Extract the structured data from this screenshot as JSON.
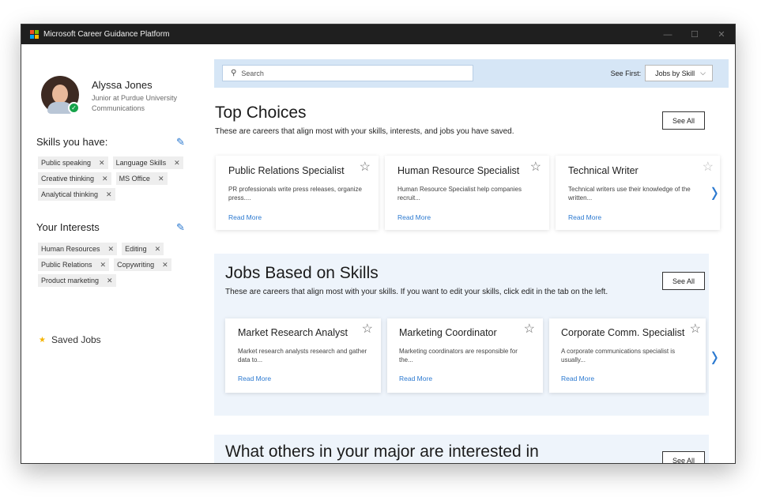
{
  "window": {
    "title": "Microsoft Career Guidance Platform",
    "logo_colors": [
      "#f25022",
      "#7fba00",
      "#00a4ef",
      "#ffb900"
    ],
    "controls": [
      "—",
      "☐",
      "✕"
    ]
  },
  "profile": {
    "name": "Alyssa Jones",
    "line1": "Junior at Purdue University",
    "line2": "Communications"
  },
  "skills": {
    "title": "Skills you have:",
    "items": [
      "Public speaking",
      "Language Skills",
      "Creative thinking",
      "MS Office",
      "Analytical thinking"
    ]
  },
  "interests": {
    "title": "Your Interests",
    "items": [
      "Human Resources",
      "Editing",
      "Public Relations",
      "Copywriting",
      "Product marketing"
    ]
  },
  "saved_jobs": {
    "label": "Saved Jobs"
  },
  "search": {
    "placeholder": "Search"
  },
  "see_first": {
    "label": "See First:",
    "value": "Jobs by Skill"
  },
  "top_choices": {
    "title": "Top Choices",
    "description": "These are careers that align most with your skills, interests, and jobs you have saved.",
    "see_all": "See All",
    "cards": [
      {
        "title": "Public Relations Specialist",
        "desc": "PR professionals write press releases, organize press....",
        "link": "Read More"
      },
      {
        "title": "Human Resource Specialist",
        "desc": "Human Resource Specialist help companies recruit...",
        "link": "Read More"
      },
      {
        "title": "Technical Writer",
        "desc": "Technical writers use their knowledge of the written...",
        "link": "Read More"
      }
    ]
  },
  "jobs_skills": {
    "title": "Jobs Based on Skills",
    "description": "These are careers that align most with your skills. If you want to edit your skills, click edit in the tab on the left.",
    "see_all": "See All",
    "cards": [
      {
        "title": "Market Research Analyst",
        "desc": "Market research analysts research and gather data to...",
        "link": "Read More"
      },
      {
        "title": "Marketing Coordinator",
        "desc": "Marketing coordinators are responsible for the...",
        "link": "Read More"
      },
      {
        "title": "Corporate Comm. Specialist",
        "desc": "A corporate communications specialist is usually...",
        "link": "Read More"
      }
    ]
  },
  "major": {
    "title": "What others in your major are interested in",
    "see_all": "See All"
  },
  "colors": {
    "accent": "#2b79d0",
    "search_band": "#d6e6f6",
    "section_band": "#eef4fb",
    "star_saved": "#f5b400",
    "verified": "#16a34a"
  }
}
